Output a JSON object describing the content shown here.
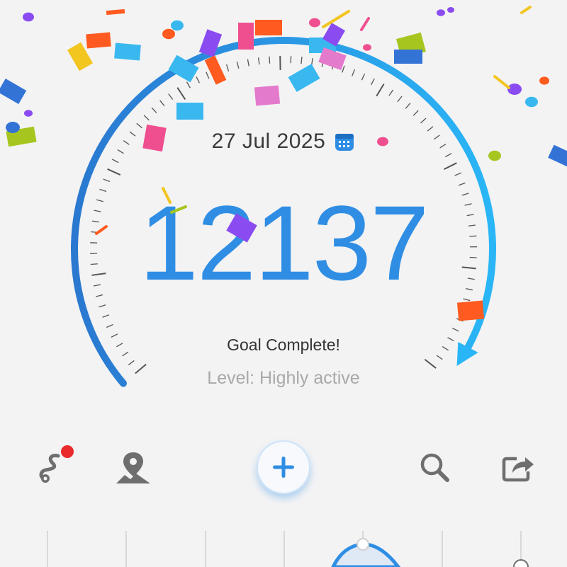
{
  "summary": {
    "date": "27 Jul 2025",
    "steps": "12137",
    "goal_status": "Goal Complete!",
    "level": "Level: Highly active",
    "progress": 1.0
  },
  "toolbar": {
    "route_has_notification": true,
    "items": [
      "route-icon",
      "map-pin-icon",
      "add-button",
      "search-icon",
      "share-icon"
    ]
  },
  "colors": {
    "accent": "#2f8ee4",
    "arc_start": "#2a78d0",
    "arc_end": "#2ab6f6",
    "notification": "#ea2a2a",
    "background": "#f3f3f4"
  }
}
